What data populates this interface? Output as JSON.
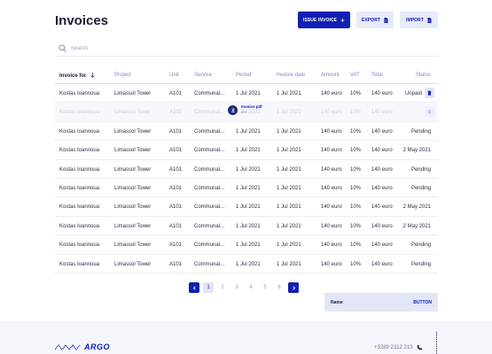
{
  "page_title": "Invoices",
  "actions": {
    "issue_label": "ISSUE INVOICE",
    "export_label": "EXPORT",
    "import_label": "IMPORT"
  },
  "search": {
    "placeholder": "Search",
    "value": ""
  },
  "table": {
    "columns": [
      "Invoice for",
      "Project",
      "Unit",
      "Service",
      "Period",
      "Invoice date",
      "Amount",
      "VAT",
      "Total",
      "Status"
    ],
    "sorted_column": "Invoice for",
    "sort_direction": "descending",
    "rows": [
      [
        "Kostas Ioannoua",
        "Limassol Tower",
        "A101",
        "Communal...",
        "1 Jul 2021",
        "1 Jul 2021",
        "140 euro",
        "10%",
        "140 euro",
        "Unpaid"
      ],
      [
        "Kostas Ioannoua",
        "Limassol Tower",
        "A101",
        "Communal...",
        "1 Jul 2021",
        "1 Jul 2021",
        "140 euro",
        "10%",
        "140 euro",
        ""
      ],
      [
        "Kostas Ioannoua",
        "Limassol Tower",
        "A101",
        "Communal...",
        "1 Jul 2021",
        "1 Jul 2021",
        "140 euro",
        "10%",
        "140 euro",
        "Pending"
      ],
      [
        "Kostas Ioannoua",
        "Limassol Tower",
        "A101",
        "Communal...",
        "1 Jul 2021",
        "1 Jul 2021",
        "140 euro",
        "10%",
        "140 euro",
        "2 May 2021"
      ],
      [
        "Kostas Ioannoua",
        "Limassol Tower",
        "A101",
        "Communal...",
        "1 Jul 2021",
        "1 Jul 2021",
        "140 euro",
        "10%",
        "140 euro",
        "Pending"
      ],
      [
        "Kostas Ioannoua",
        "Limassol Tower",
        "A101",
        "Communal...",
        "1 Jul 2021",
        "1 Jul 2021",
        "140 euro",
        "10%",
        "140 euro",
        "Pending"
      ],
      [
        "Kostas Ioannoua",
        "Limassol Tower",
        "A101",
        "Communal...",
        "1 Jul 2021",
        "1 Jul 2021",
        "140 euro",
        "10%",
        "140 euro",
        "2 May 2021"
      ],
      [
        "Kostas Ioannoua",
        "Limassol Tower",
        "A101",
        "Communal...",
        "1 Jul 2021",
        "1 Jul 2021",
        "140 euro",
        "10%",
        "140 euro",
        "2 May 2021"
      ],
      [
        "Kostas Ioannoua",
        "Limassol Tower",
        "A101",
        "Communal...",
        "1 Jul 2021",
        "1 Jul 2021",
        "140 euro",
        "10%",
        "140 euro",
        "Pending"
      ],
      [
        "Kostas Ioannoua",
        "Limassol Tower",
        "A101",
        "Communal...",
        "1 Jul 2021",
        "1 Jul 2021",
        "140 euro",
        "10%",
        "140 euro",
        "Pending"
      ]
    ],
    "download": {
      "file": "Invoice.pdf",
      "progress": "6%"
    }
  },
  "pagination": {
    "pages": [
      "1",
      "2",
      "3",
      "4",
      "5",
      "6"
    ],
    "current": "1"
  },
  "panel": {
    "name": "Name",
    "button": "BUTTON"
  },
  "footer": {
    "brand": "ARGO",
    "phone": "+3289 2312 213"
  },
  "colors": {
    "accent": "#1020b4",
    "accent_light": "#e7eaf8",
    "footer_bg": "#f4f6fb"
  },
  "icons": [
    "plus-icon",
    "file-icon",
    "search-icon",
    "sort-arrow-icon",
    "trash-icon",
    "download-icon",
    "chevron-left-icon",
    "chevron-right-icon",
    "phone-icon"
  ]
}
